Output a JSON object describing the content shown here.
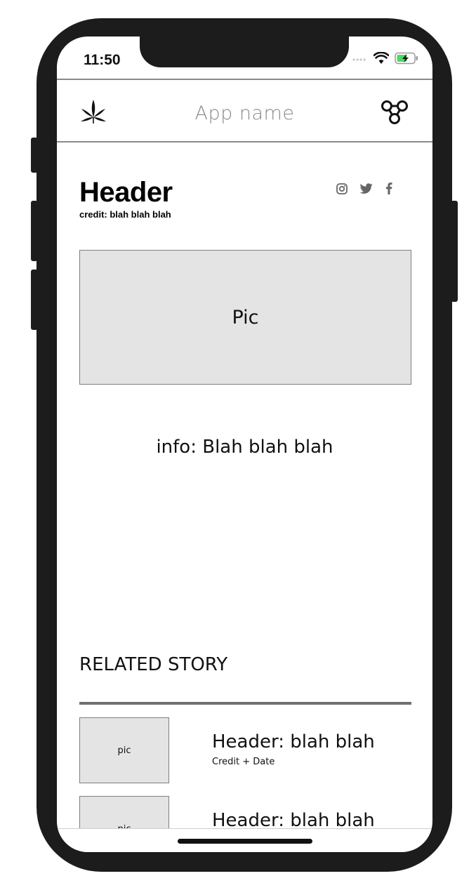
{
  "status_bar": {
    "time": "11:50"
  },
  "nav": {
    "app_name": "App name",
    "logo_icon": "cannabis-leaf-icon",
    "menu_icon": "share-nodes-icon"
  },
  "article": {
    "header": "Header",
    "credit": "credit: blah blah blah",
    "pic_label": "Pic",
    "info": "info: Blah blah blah",
    "social_icons": [
      "instagram-icon",
      "twitter-icon",
      "facebook-icon"
    ]
  },
  "related": {
    "title": "RELATED STORY",
    "stories": [
      {
        "thumb_label": "pic",
        "header": "Header: blah blah",
        "credit": "Credit + Date"
      },
      {
        "thumb_label": "pic",
        "header": "Header: blah blah",
        "credit": ""
      }
    ]
  },
  "colors": {
    "frame": "#1c1c1c",
    "nav_text": "#8a8a8a",
    "placeholder_fill": "#e4e4e4",
    "battery_green": "#4cd964"
  }
}
